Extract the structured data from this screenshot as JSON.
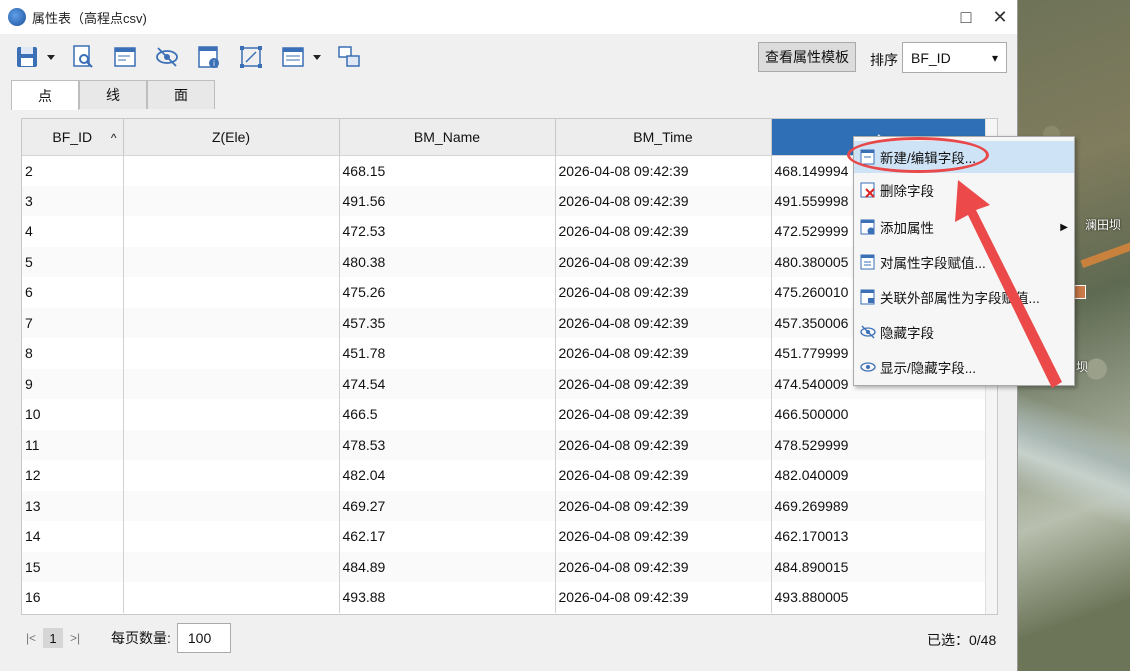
{
  "window": {
    "title": "属性表（高程点csv)",
    "minimize": "□",
    "close": "✕"
  },
  "toolbar": {
    "view_template_label": "查看属性模板",
    "sort_label": "排序",
    "sort_value": "BF_ID",
    "icons": [
      "save-icon",
      "dropdown-icon",
      "search-record-icon",
      "edit-table-icon",
      "hide-eye-icon",
      "info-icon",
      "edit-geometry-icon",
      "table-menu-icon",
      "dropdown-icon",
      "window-switch-icon"
    ]
  },
  "tabs": [
    "点",
    "线",
    "面"
  ],
  "table": {
    "columns": [
      "BF_ID",
      "Z(Ele)",
      "BM_Name",
      "BM_Time",
      "↑"
    ],
    "sort_indicator": "^",
    "rows": [
      [
        "2",
        "",
        "468.15",
        "2026-04-08 09:42:39",
        "468.149994"
      ],
      [
        "3",
        "",
        "491.56",
        "2026-04-08 09:42:39",
        "491.559998"
      ],
      [
        "4",
        "",
        "472.53",
        "2026-04-08 09:42:39",
        "472.529999"
      ],
      [
        "5",
        "",
        "480.38",
        "2026-04-08 09:42:39",
        "480.380005"
      ],
      [
        "6",
        "",
        "475.26",
        "2026-04-08 09:42:39",
        "475.260010"
      ],
      [
        "7",
        "",
        "457.35",
        "2026-04-08 09:42:39",
        "457.350006"
      ],
      [
        "8",
        "",
        "451.78",
        "2026-04-08 09:42:39",
        "451.779999"
      ],
      [
        "9",
        "",
        "474.54",
        "2026-04-08 09:42:39",
        "474.540009"
      ],
      [
        "10",
        "",
        "466.5",
        "2026-04-08 09:42:39",
        "466.500000"
      ],
      [
        "11",
        "",
        "478.53",
        "2026-04-08 09:42:39",
        "478.529999"
      ],
      [
        "12",
        "",
        "482.04",
        "2026-04-08 09:42:39",
        "482.040009"
      ],
      [
        "13",
        "",
        "469.27",
        "2026-04-08 09:42:39",
        "469.269989"
      ],
      [
        "14",
        "",
        "462.17",
        "2026-04-08 09:42:39",
        "462.170013"
      ],
      [
        "15",
        "",
        "484.89",
        "2026-04-08 09:42:39",
        "484.890015"
      ],
      [
        "16",
        "",
        "493.88",
        "2026-04-08 09:42:39",
        "493.880005"
      ]
    ]
  },
  "pager": {
    "first": "|<",
    "page": "1",
    "last": ">|",
    "per_page_label": "每页数量:",
    "per_page_value": "100",
    "selected_label": "已选：0/48"
  },
  "context_menu": {
    "items": [
      {
        "label": "新建/编辑字段...",
        "icon": "edit-field-icon"
      },
      {
        "label": "删除字段",
        "icon": "delete-field-icon"
      },
      {
        "label": "添加属性",
        "icon": "add-attribute-icon",
        "submenu": "▶"
      },
      {
        "label": "对属性字段赋值...",
        "icon": "assign-value-icon"
      },
      {
        "label": "关联外部属性为字段赋值...",
        "icon": "link-external-icon"
      },
      {
        "label": "隐藏字段",
        "icon": "hide-field-icon"
      },
      {
        "label": "显示/隐藏字段...",
        "icon": "show-hide-field-icon"
      }
    ]
  },
  "map": {
    "labels": [
      "澜田坝",
      "坝"
    ]
  },
  "colors": {
    "selected_header": "#2f6fb5",
    "highlight": "#e84848"
  }
}
